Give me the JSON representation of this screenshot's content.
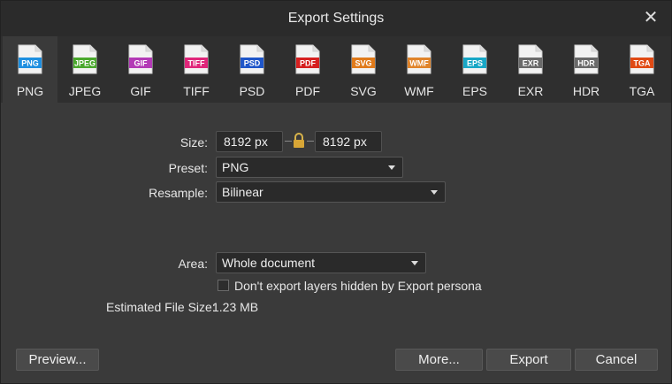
{
  "window": {
    "title": "Export Settings",
    "close_glyph": "✕"
  },
  "formats": [
    {
      "label": "PNG",
      "color": "#1e8fe0",
      "selected": true
    },
    {
      "label": "JPEG",
      "color": "#4aa82d",
      "selected": false
    },
    {
      "label": "GIF",
      "color": "#b33ab6",
      "selected": false
    },
    {
      "label": "TIFF",
      "color": "#e0267a",
      "selected": false
    },
    {
      "label": "PSD",
      "color": "#1f56c9",
      "selected": false
    },
    {
      "label": "PDF",
      "color": "#d62020",
      "selected": false
    },
    {
      "label": "SVG",
      "color": "#e07a1a",
      "selected": false
    },
    {
      "label": "WMF",
      "color": "#e0842a",
      "selected": false
    },
    {
      "label": "EPS",
      "color": "#18a7c6",
      "selected": false
    },
    {
      "label": "EXR",
      "color": "#6a6a6a",
      "selected": false
    },
    {
      "label": "HDR",
      "color": "#6a6a6a",
      "selected": false
    },
    {
      "label": "TGA",
      "color": "#e04a14",
      "selected": false
    }
  ],
  "settings": {
    "size_label": "Size:",
    "width_value": "8192 px",
    "height_value": "8192 px",
    "preset_label": "Preset:",
    "preset_value": "PNG",
    "resample_label": "Resample:",
    "resample_value": "Bilinear",
    "area_label": "Area:",
    "area_value": "Whole document",
    "hidden_layers_label": "Don't export layers hidden by Export persona",
    "hidden_layers_checked": false,
    "filesize_label": "Estimated File Size:",
    "filesize_value": "1.23 MB"
  },
  "buttons": {
    "preview": "Preview...",
    "more": "More...",
    "export": "Export",
    "cancel": "Cancel"
  }
}
